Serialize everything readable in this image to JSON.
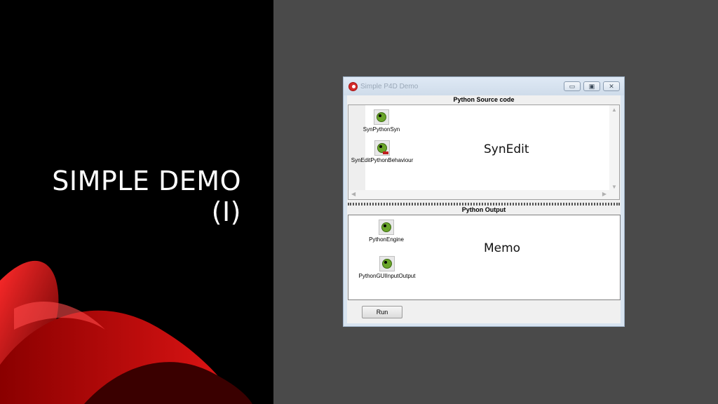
{
  "slide": {
    "title_line1": "SIMPLE DEMO",
    "title_line2": "(I)"
  },
  "window": {
    "title": "Simple P4D Demo",
    "buttons": {
      "minimize": "▭",
      "maximize": "▣",
      "close": "✕"
    },
    "source_header": "Python Source code",
    "output_header": "Python Output",
    "editor_label": "SynEdit",
    "memo_label": "Memo",
    "run_label": "Run",
    "components_top": [
      {
        "label": "SynPythonSyn",
        "icon": "python-highlighter-icon"
      },
      {
        "label": "SynEditPythonBehaviour",
        "icon": "python-behaviour-icon"
      }
    ],
    "components_bottom": [
      {
        "label": "PythonEngine",
        "icon": "python-engine-icon"
      },
      {
        "label": "PythonGUIInputOutput",
        "icon": "python-io-icon"
      }
    ]
  },
  "colors": {
    "background": "#4a4a4a",
    "left_panel": "#000000",
    "accent_red": "#c41010"
  }
}
